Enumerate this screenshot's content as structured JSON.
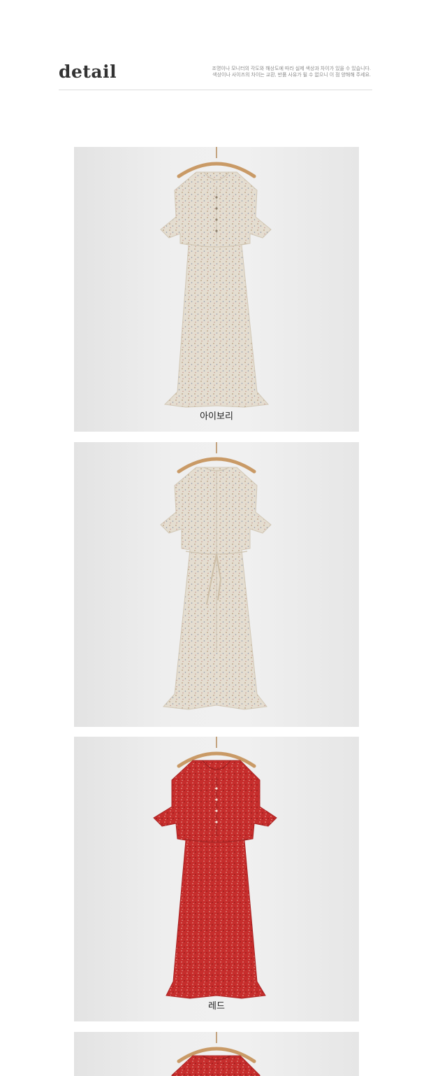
{
  "header": {
    "title": "detail",
    "note_line1": "조명이나 모니터의 각도와 해상도에 따라 실제 색상과 차이가 있을 수 있습니다.",
    "note_line2": "색상이나 사이즈의 차이는 교환, 반품 사유가 될 수 없으니 이 점 양해해 주세요."
  },
  "photos": [
    {
      "caption": "아이보리",
      "color": "ivory-floral",
      "view": "front"
    },
    {
      "caption": "",
      "color": "ivory-floral",
      "view": "back"
    },
    {
      "caption": "레드",
      "color": "red-floral",
      "view": "front"
    },
    {
      "caption": "",
      "color": "red-floral",
      "view": "front-cropped"
    }
  ],
  "colors": {
    "ivory": "#e4ddd0",
    "red": "#c62d2c",
    "hanger": "#c99a66"
  }
}
